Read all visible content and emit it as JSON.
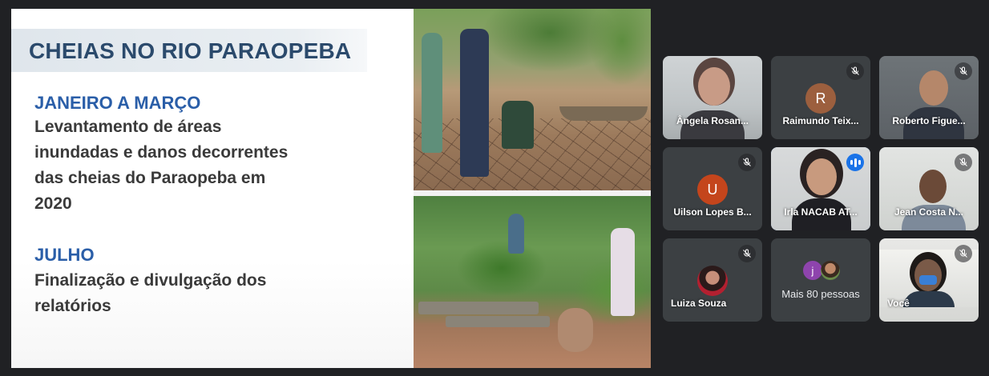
{
  "slide": {
    "title": "CHEIAS NO RIO PARAOPEBA",
    "section1_heading": "JANEIRO A MARÇO",
    "section1_body": "Levantamento de áreas inundadas e danos decorrentes das cheias do Paraopeba em 2020",
    "section2_heading": "JULHO",
    "section2_body": "Finalização e divulgação dos relatórios"
  },
  "participants": [
    {
      "name": "Ângela Rosan...",
      "muted": false,
      "type": "video"
    },
    {
      "name": "Raimundo Teix...",
      "muted": true,
      "type": "avatar",
      "initial": "R",
      "color": "#9c5f3e"
    },
    {
      "name": "Roberto Figue...",
      "muted": true,
      "type": "video"
    },
    {
      "name": "Uilson Lopes B...",
      "muted": true,
      "type": "avatar",
      "initial": "U",
      "color": "#c4451c"
    },
    {
      "name": "Irla NACAB AT...",
      "muted": false,
      "type": "video",
      "speaking": true
    },
    {
      "name": "Jean Costa N...",
      "muted": true,
      "type": "video"
    },
    {
      "name": "Luiza Souza",
      "muted": true,
      "type": "photo-avatar"
    },
    {
      "name": "Mais 80 pessoas",
      "type": "more",
      "initial": "j"
    },
    {
      "name": "Você",
      "muted": true,
      "type": "video"
    }
  ],
  "colors": {
    "background": "#202124",
    "tile": "#3c4043",
    "accent": "#1a73e8",
    "title": "#2b4a6c",
    "heading": "#2a5ea8"
  },
  "icons": {
    "mute": "mic-off-icon",
    "speaking": "audio-level-icon"
  }
}
